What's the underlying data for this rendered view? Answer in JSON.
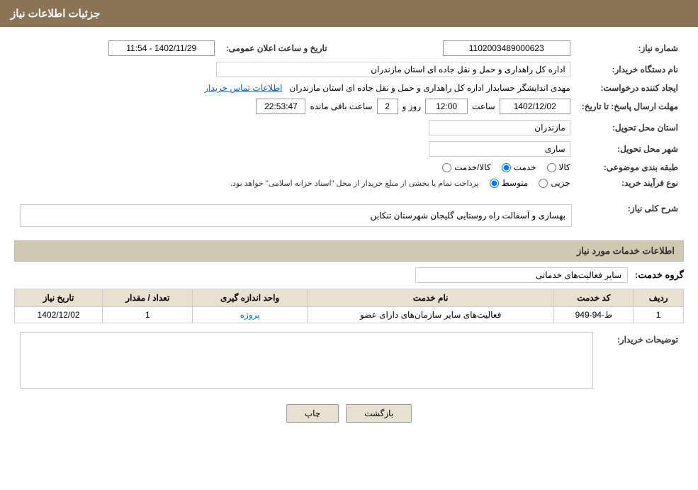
{
  "header": {
    "title": "جزئیات اطلاعات نیاز"
  },
  "fields": {
    "need_number_label": "شماره نیاز:",
    "need_number_value": "1102003489000623",
    "date_label": "تاریخ و ساعت اعلان عمومی:",
    "date_value": "1402/11/29 - 11:54",
    "org_name_label": "نام دستگاه خریدار:",
    "org_name_value": "اداره کل راهداری و حمل و نقل جاده ای استان مازندران",
    "requester_label": "ایجاد کننده درخواست:",
    "requester_value": "مهدی اندایشگر حسابدار اداره کل راهداری و حمل و نقل جاده ای استان مازندران",
    "contact_link": "اطلاعات تماس خریدار",
    "deadline_label": "مهلت ارسال پاسخ: تا تاریخ:",
    "deadline_date": "1402/12/02",
    "deadline_time": "12:00",
    "deadline_days": "2",
    "deadline_remaining": "22:53:47",
    "deadline_time_label": "ساعت",
    "deadline_days_label": "روز و",
    "deadline_remaining_label": "ساعت باقی مانده",
    "province_label": "استان محل تحویل:",
    "province_value": "مازندران",
    "city_label": "شهر محل تحویل:",
    "city_value": "ساری",
    "category_label": "طبقه بندی موضوعی:",
    "category_options": [
      "کالا",
      "خدمت",
      "کالا/خدمت"
    ],
    "category_selected": "خدمت",
    "purchase_type_label": "نوع فرآیند خرید:",
    "purchase_options": [
      "جزیی",
      "متوسط"
    ],
    "purchase_note": "پرداخت تمام یا بخشی از مبلغ خریدار از محل \"اسناد خزانه اسلامی\" خواهد بود.",
    "description_label": "شرح کلی نیاز:",
    "description_value": "بهسازی و آسفالت راه روستایی گلیجان شهرستان تنکابن",
    "services_section": "اطلاعات خدمات مورد نیاز",
    "service_group_label": "گروه خدمت:",
    "service_group_value": "سایر فعالیت‌های خدماتی",
    "table": {
      "headers": [
        "ردیف",
        "کد خدمت",
        "نام خدمت",
        "واحد اندازه گیری",
        "تعداد / مقدار",
        "تاریخ نیاز"
      ],
      "rows": [
        {
          "row": "1",
          "code": "ط-94-949",
          "name": "فعالیت‌های سایر سازمان‌های دارای عضو",
          "unit": "پروژه",
          "quantity": "1",
          "date": "1402/12/02"
        }
      ]
    },
    "buyer_notes_label": "توضیحات خریدار:",
    "btn_print": "چاپ",
    "btn_back": "بازگشت"
  }
}
